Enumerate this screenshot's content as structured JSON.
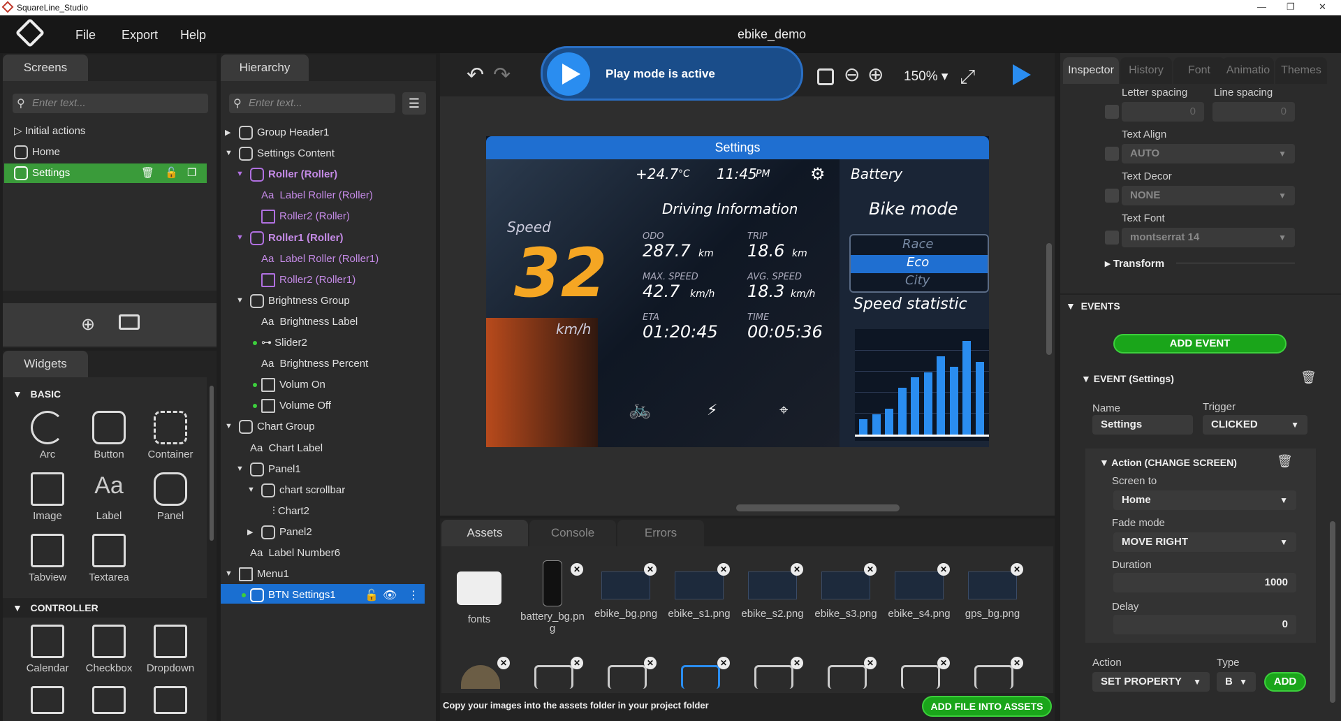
{
  "app": {
    "title": "SquareLine_Studio",
    "project": "ebike_demo"
  },
  "menu": [
    "File",
    "Export",
    "Help"
  ],
  "screens": {
    "tab": "Screens",
    "search_placeholder": "Enter text...",
    "items": [
      "Initial actions",
      "Home",
      "Settings"
    ]
  },
  "widgets": {
    "tab": "Widgets",
    "basic_title": "BASIC",
    "basic": [
      "Arc",
      "Button",
      "Container",
      "Image",
      "Label",
      "Panel",
      "Tabview",
      "Textarea"
    ],
    "controller_title": "CONTROLLER",
    "controller": [
      "Calendar",
      "Checkbox",
      "Dropdown"
    ]
  },
  "hierarchy": {
    "tab": "Hierarchy",
    "search_placeholder": "Enter text...",
    "items": [
      "Group Header1",
      "Settings Content",
      "Roller (Roller)",
      "Label Roller (Roller)",
      "Roller2 (Roller)",
      "Roller1 (Roller)",
      "Label Roller (Roller1)",
      "Roller2 (Roller1)",
      "Brightness Group",
      "Brightness Label",
      "Slider2",
      "Brightness Percent",
      "Volum On",
      "Volume Off",
      "Chart Group",
      "Chart Label",
      "Panel1",
      "chart scrollbar",
      "Chart2",
      "Panel2",
      "Label Number6",
      "Menu1",
      "BTN Settings1"
    ]
  },
  "toolbar": {
    "play_status": "Play mode is active",
    "zoom": "150%"
  },
  "device": {
    "header": "Settings",
    "temp": "+24.7",
    "temp_unit": "°C",
    "time": "11:45",
    "ampm": "PM",
    "battery": "Battery",
    "driving_info": "Driving Information",
    "bike_mode": "Bike mode",
    "modes": [
      "Race",
      "Eco",
      "City"
    ],
    "speed_label": "Speed",
    "speed": "32",
    "speed_unit": "km/h",
    "odo_label": "ODO",
    "odo": "287.7",
    "trip_label": "TRIP",
    "trip": "18.6",
    "km": "km",
    "maxspeed_label": "MAX. SPEED",
    "maxspeed": "42.7",
    "avgspeed_label": "AVG. SPEED",
    "avgspeed": "18.3",
    "kmh": "km/h",
    "eta_label": "ETA",
    "eta": "01:20:45",
    "time_label": "TIME",
    "time_val": "00:05:36",
    "speed_stat": "Speed statistic",
    "bars": [
      0.15,
      0.2,
      0.25,
      0.45,
      0.55,
      0.6,
      0.75,
      0.65,
      0.9,
      0.7
    ]
  },
  "bottom": {
    "tabs": [
      "Assets",
      "Console",
      "Errors"
    ],
    "assets": [
      "fonts",
      "battery_bg.png",
      "ebike_bg.png",
      "ebike_s1.png",
      "ebike_s2.png",
      "ebike_s3.png",
      "ebike_s4.png",
      "gps_bg.png"
    ],
    "hint": "Copy your images into the assets folder in your project folder",
    "add_file": "ADD FILE INTO ASSETS"
  },
  "inspector": {
    "tabs": [
      "Inspector",
      "History",
      "Font",
      "Animatio",
      "Themes"
    ],
    "letter_spacing": "Letter spacing",
    "line_spacing": "Line spacing",
    "ls_val": "0",
    "lsp_val": "0",
    "text_align": "Text Align",
    "align_val": "AUTO",
    "text_decor": "Text Decor",
    "decor_val": "NONE",
    "text_font": "Text Font",
    "font_val": "montserrat 14",
    "transform": "Transform",
    "events": "EVENTS",
    "add_event": "ADD EVENT",
    "event_title": "EVENT (Settings)",
    "name_label": "Name",
    "name_val": "Settings",
    "trigger_label": "Trigger",
    "trigger_val": "CLICKED",
    "action_title": "Action (CHANGE SCREEN)",
    "screen_to": "Screen to",
    "screen_val": "Home",
    "fade_mode": "Fade mode",
    "fade_val": "MOVE RIGHT",
    "duration": "Duration",
    "duration_val": "1000",
    "delay": "Delay",
    "delay_val": "0",
    "action_label": "Action",
    "type_label": "Type",
    "action_val": "SET PROPERTY",
    "type_val": "B",
    "add": "ADD"
  }
}
